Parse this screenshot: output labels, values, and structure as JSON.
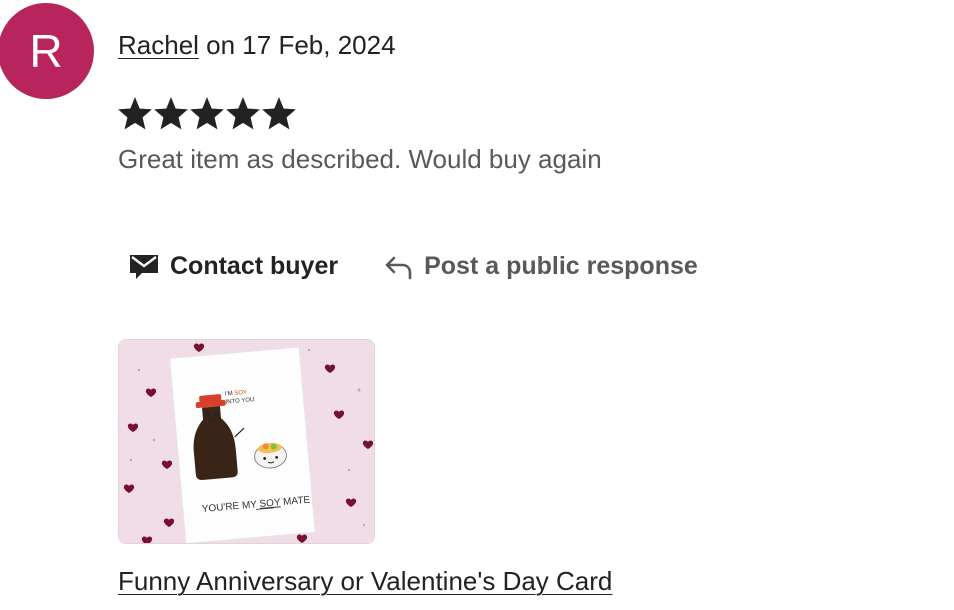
{
  "colors": {
    "avatar_bg": "#b8245c",
    "star": "#222222",
    "text_primary": "#222222",
    "text_secondary": "#595959",
    "card_bg": "#f0dde7",
    "heart": "#7a1030",
    "soy_cap": "#d8402c"
  },
  "review": {
    "avatar_initial": "R",
    "reviewer_name": "Rachel",
    "date_text": " on 17 Feb, 2024",
    "rating": 5,
    "rating_max": 5,
    "text": "Great item as described. Would buy again"
  },
  "actions": {
    "contact_label": "Contact buyer",
    "contact_icon": "envelope-icon",
    "respond_label": "Post a public response",
    "respond_icon": "reply-arrow-icon"
  },
  "product": {
    "title": "Funny Anniversary or Valentine's Day Card",
    "card_speech": "I'M SOY INTO YOU",
    "card_caption": "YOU'RE MY SOY MATE"
  }
}
